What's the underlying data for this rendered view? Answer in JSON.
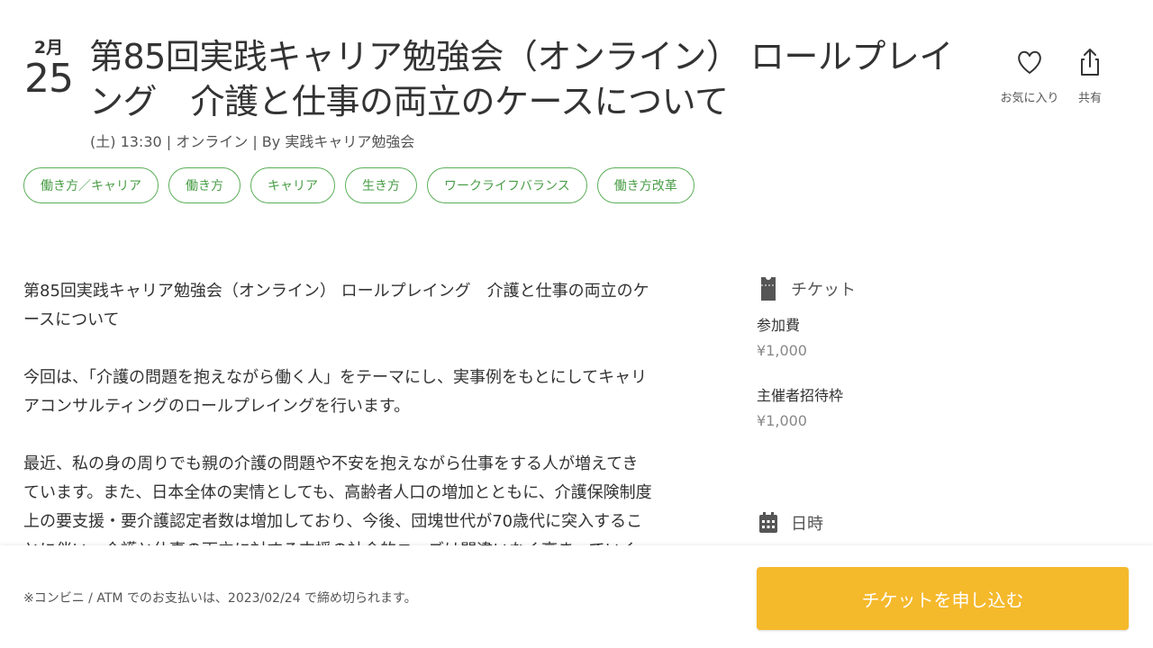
{
  "event": {
    "month": "2月",
    "day": "25",
    "title": "第85回実践キャリア勉強会（オンライン） ロールプレイング　介護と仕事の両立のケースについて",
    "meta": "(土) 13:30 | オンライン | By 実践キャリア勉強会"
  },
  "actions": {
    "favorite_label": "お気に入り",
    "share_label": "共有"
  },
  "tags": [
    "働き方／キャリア",
    "働き方",
    "キャリア",
    "生き方",
    "ワークライフバランス",
    "働き方改革"
  ],
  "description": {
    "p1": "第85回実践キャリア勉強会（オンライン） ロールプレイング　介護と仕事の両立のケースについて",
    "p2": "今回は、「介護の問題を抱えながら働く人」をテーマにし、実事例をもとにしてキャリアコンサルティングのロールプレイングを行います。",
    "p3": "最近、私の身の周りでも親の介護の問題や不安を抱えながら仕事をする人が増えてきています。また、日本全体の実情としても、高齢者人口の増加とともに、介護保険制度上の要支援・要介護認定者数は増加しており、今後、団塊世代が70歳代に突入することに伴い、介護と仕事の両立に対する支援の社会的ニーズは間違いなく高まっていく"
  },
  "tickets": {
    "heading": "チケット",
    "items": [
      {
        "label": "参加費",
        "price": "¥1,000"
      },
      {
        "label": "主催者招待枠",
        "price": "¥1,000"
      }
    ]
  },
  "datetime": {
    "heading": "日時"
  },
  "footer": {
    "note": "※コンビニ / ATM でのお支払いは、2023/02/24 で締め切られます。",
    "apply_label": "チケットを申し込む"
  },
  "colors": {
    "tag_green": "#5aae57",
    "apply_yellow": "#f5b92c"
  }
}
